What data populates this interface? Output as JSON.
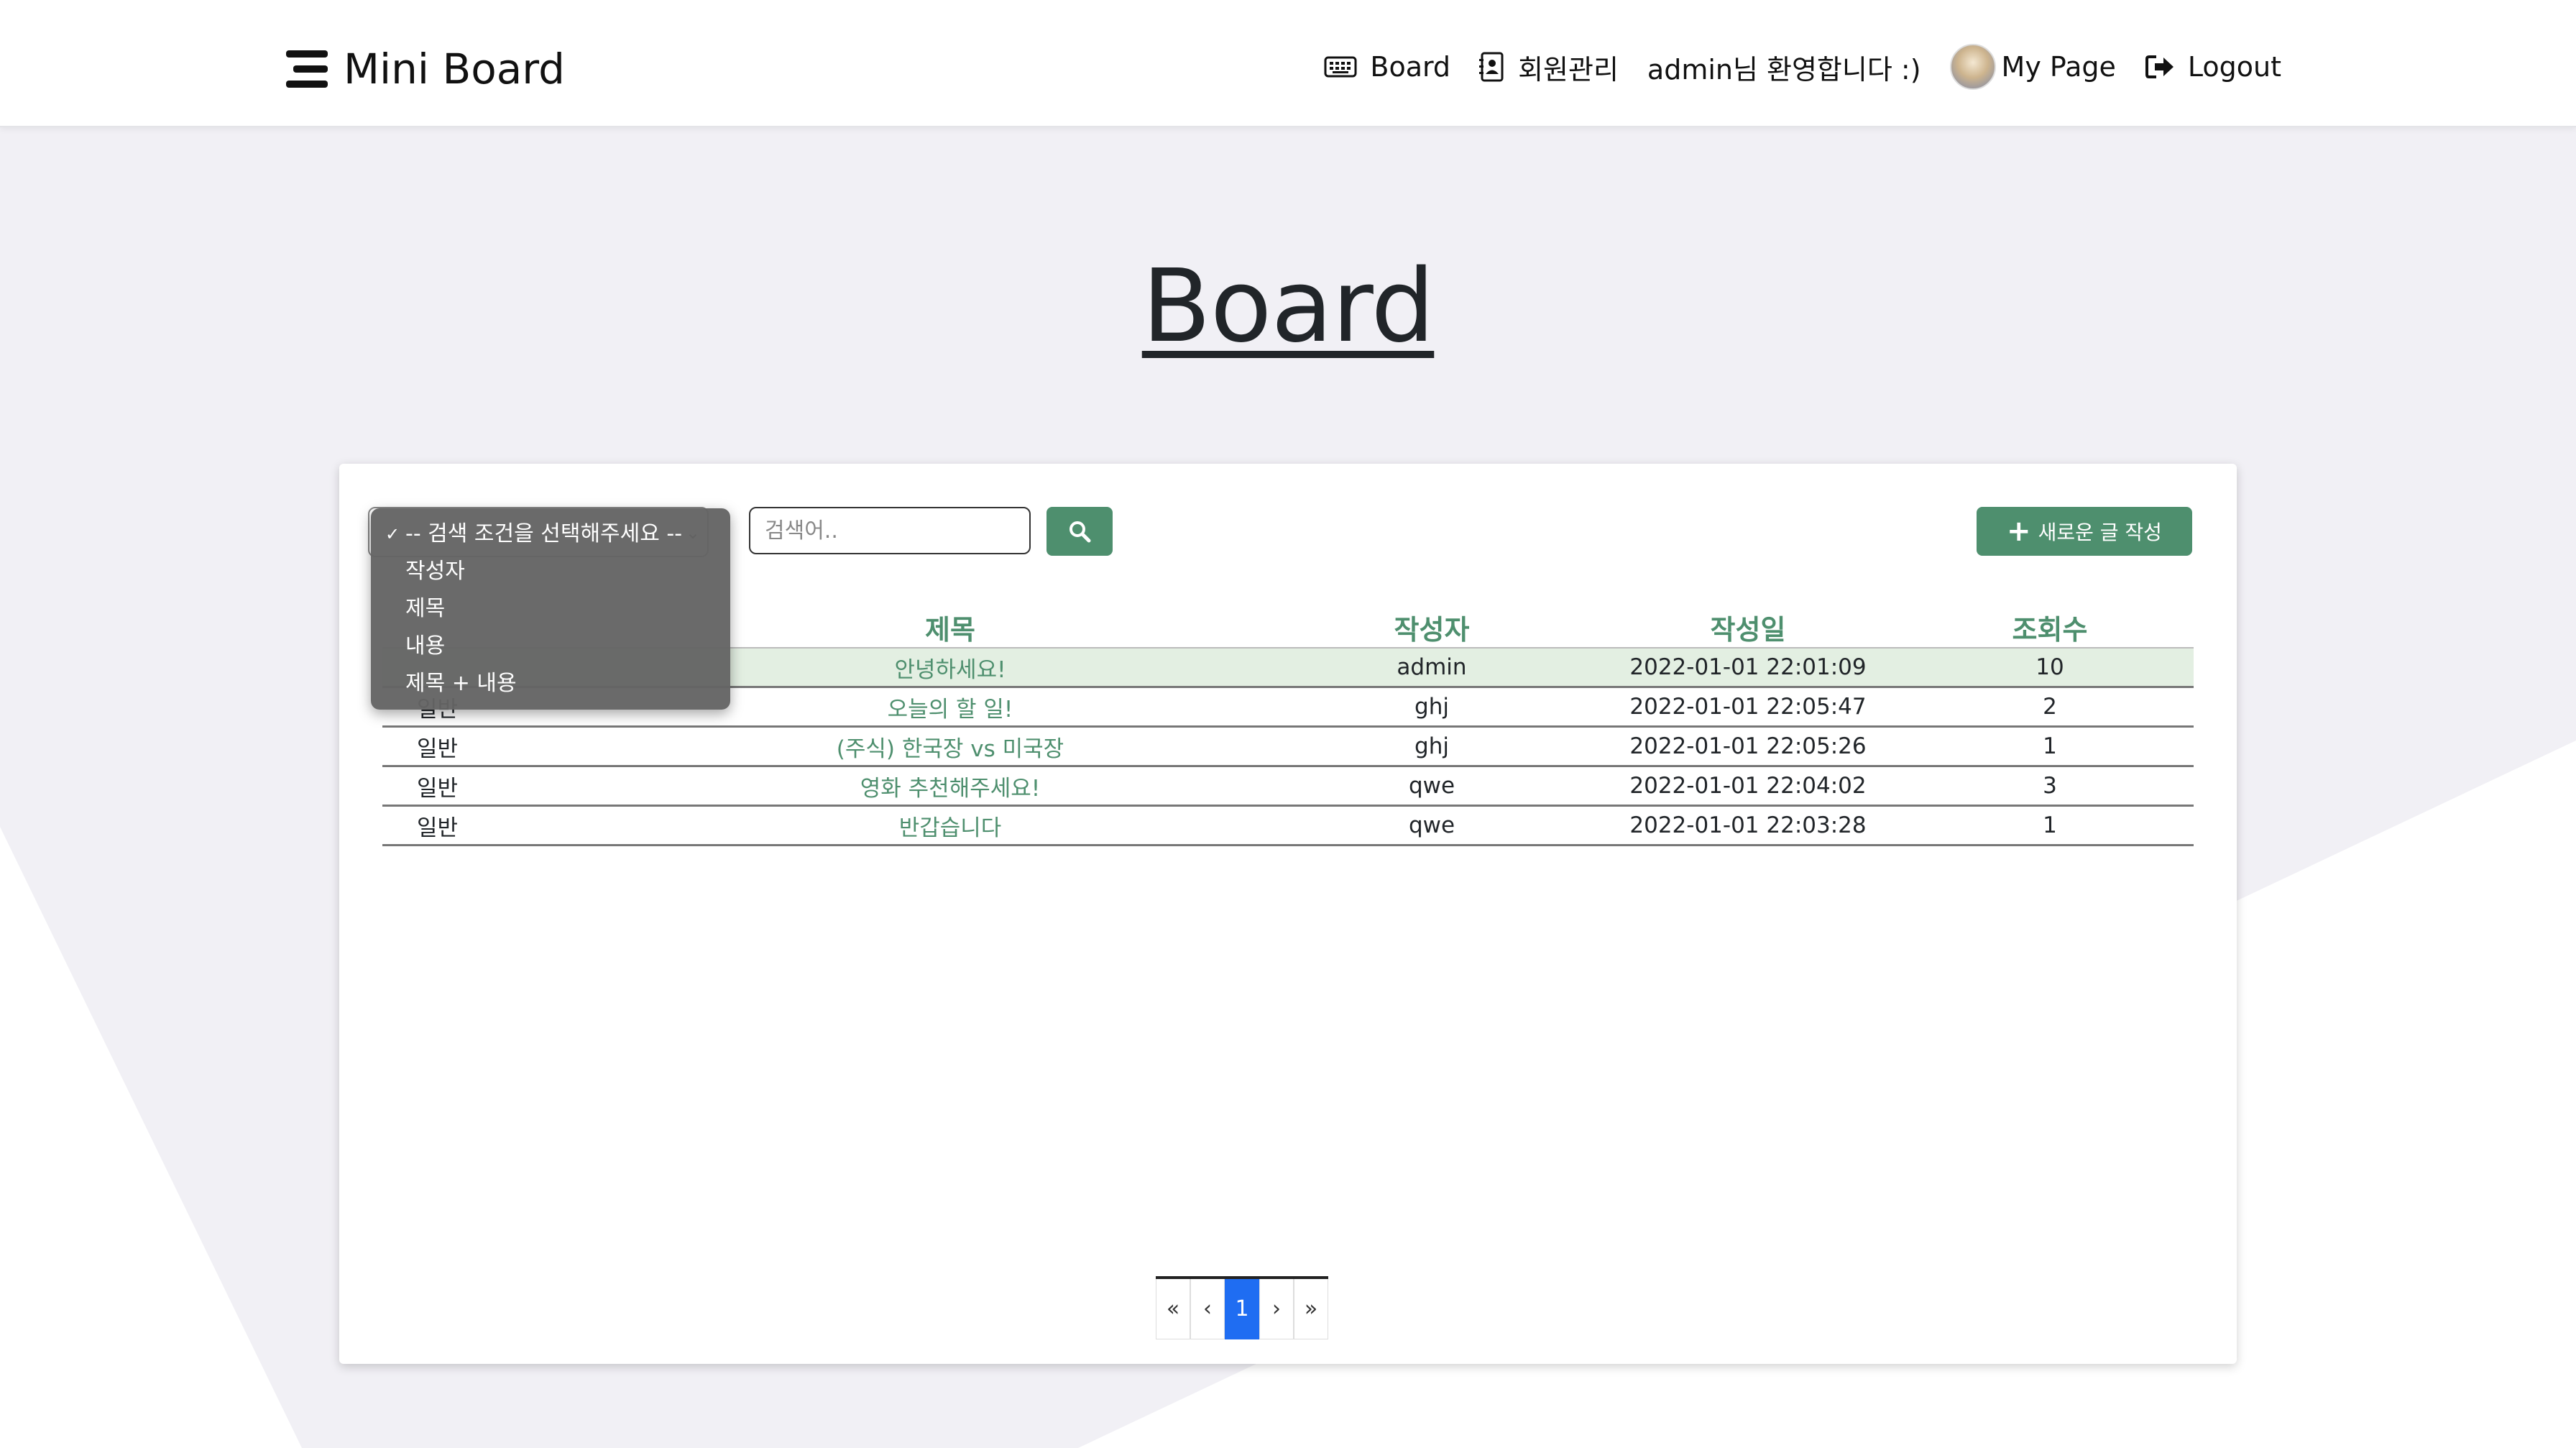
{
  "brand": {
    "name": "Mini Board"
  },
  "nav": {
    "board": "Board",
    "members": "회원관리",
    "welcome": "admin님 환영합니다 :)",
    "mypage": "My Page",
    "logout": "Logout"
  },
  "page_title": "Board",
  "search": {
    "placeholder": "검색어..",
    "options": [
      "-- 검색 조건을 선택해주세요 --",
      "작성자",
      "제목",
      "내용",
      "제목 + 내용"
    ],
    "selected": "-- 검색 조건을 선택해주세요 --"
  },
  "new_post_label": "새로운 글 작성",
  "table": {
    "headers": [
      "제목",
      "작성자",
      "작성일",
      "조회수"
    ],
    "rows": [
      {
        "category": "",
        "title": "안녕하세요!",
        "author": "admin",
        "date": "2022-01-01 22:01:09",
        "views": "10"
      },
      {
        "category": "일반",
        "title": "오늘의 할 일!",
        "author": "ghj",
        "date": "2022-01-01 22:05:47",
        "views": "2"
      },
      {
        "category": "일반",
        "title": "(주식) 한국장 vs 미국장",
        "author": "ghj",
        "date": "2022-01-01 22:05:26",
        "views": "1"
      },
      {
        "category": "일반",
        "title": "영화 추천해주세요!",
        "author": "qwe",
        "date": "2022-01-01 22:04:02",
        "views": "3"
      },
      {
        "category": "일반",
        "title": "반갑습니다",
        "author": "qwe",
        "date": "2022-01-01 22:03:28",
        "views": "1"
      }
    ]
  },
  "pagination": {
    "first": "«",
    "prev": "‹",
    "current": "1",
    "next": "›",
    "last": "»"
  },
  "colors": {
    "accent": "#4e8f6e",
    "active_page": "#1f6df2",
    "highlight_row": "#e3efe2"
  }
}
